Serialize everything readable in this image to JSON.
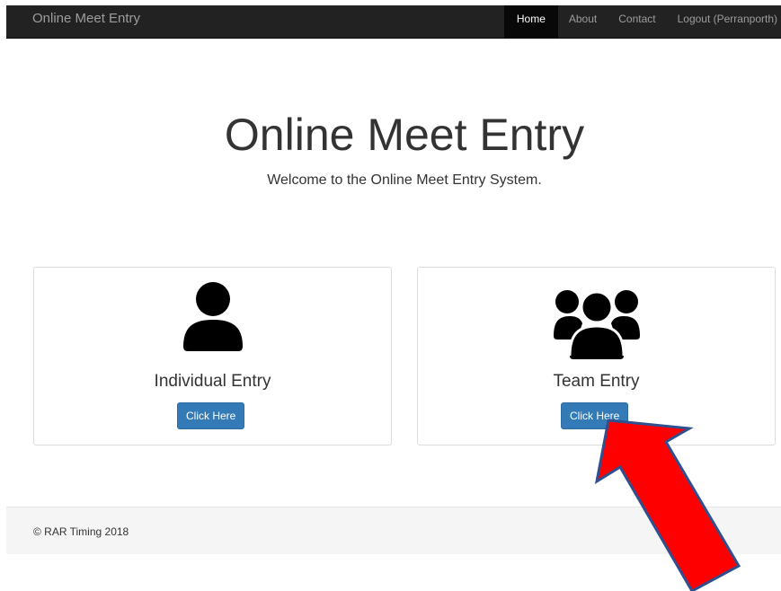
{
  "navbar": {
    "brand": "Online Meet Entry",
    "items": [
      {
        "label": "Home",
        "active": true
      },
      {
        "label": "About",
        "active": false
      },
      {
        "label": "Contact",
        "active": false
      },
      {
        "label": "Logout (Perranporth)",
        "active": false
      }
    ]
  },
  "hero": {
    "title": "Online Meet Entry",
    "subtitle": "Welcome to the Online Meet Entry System."
  },
  "panels": [
    {
      "icon": "user-icon",
      "title": "Individual Entry",
      "button": "Click Here"
    },
    {
      "icon": "users-icon",
      "title": "Team Entry",
      "button": "Click Here"
    }
  ],
  "footer": {
    "text": "© RAR Timing 2018"
  },
  "annotation": {
    "icon": "red-arrow-icon",
    "color": "#ff0000",
    "outline_color": "#2f4f8f"
  },
  "colors": {
    "navbar_bg": "#222222",
    "button_primary": "#337ab7",
    "footer_bg": "#f5f5f5"
  }
}
